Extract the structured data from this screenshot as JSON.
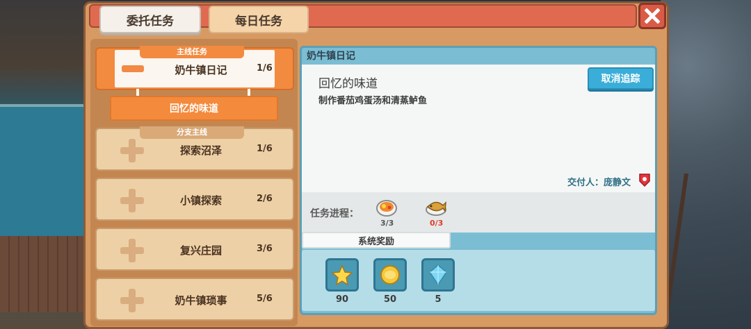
{
  "tabs": {
    "commission": "委托任务",
    "daily": "每日任务"
  },
  "quest_list": [
    {
      "category": "主线任务",
      "name": "奶牛镇日记",
      "progress": "1/6",
      "active": true
    },
    {
      "category": "分支主线",
      "name": "探索沼泽",
      "progress": "1/6",
      "active": false
    },
    {
      "category": "",
      "name": "小镇探索",
      "progress": "2/6",
      "active": false
    },
    {
      "category": "",
      "name": "复兴庄园",
      "progress": "3/6",
      "active": false
    },
    {
      "category": "",
      "name": "奶牛镇琐事",
      "progress": "5/6",
      "active": false
    }
  ],
  "subquest": "回忆的味道",
  "detail": {
    "header": "奶牛镇日记",
    "title": "回忆的味道",
    "description": "制作番茄鸡蛋汤和清蒸鲈鱼",
    "untrack_button": "取消追踪",
    "giver": "交付人：庞静文",
    "progress_label": "任务进程：",
    "items": [
      {
        "icon": "tomato-egg-soup-icon",
        "count": "3/3",
        "color": "#555555"
      },
      {
        "icon": "steamed-perch-icon",
        "count": "0/3",
        "color": "#e03a2a"
      }
    ],
    "reward_tab": "系统奖励",
    "rewards": [
      {
        "icon": "star-icon",
        "value": "90"
      },
      {
        "icon": "coin-icon",
        "value": "50"
      },
      {
        "icon": "crystal-icon",
        "value": "5"
      }
    ]
  },
  "colors": {
    "active_orange": "#f28a40",
    "accent_blue": "#3aaed8",
    "panel_brown": "#d79a62"
  }
}
